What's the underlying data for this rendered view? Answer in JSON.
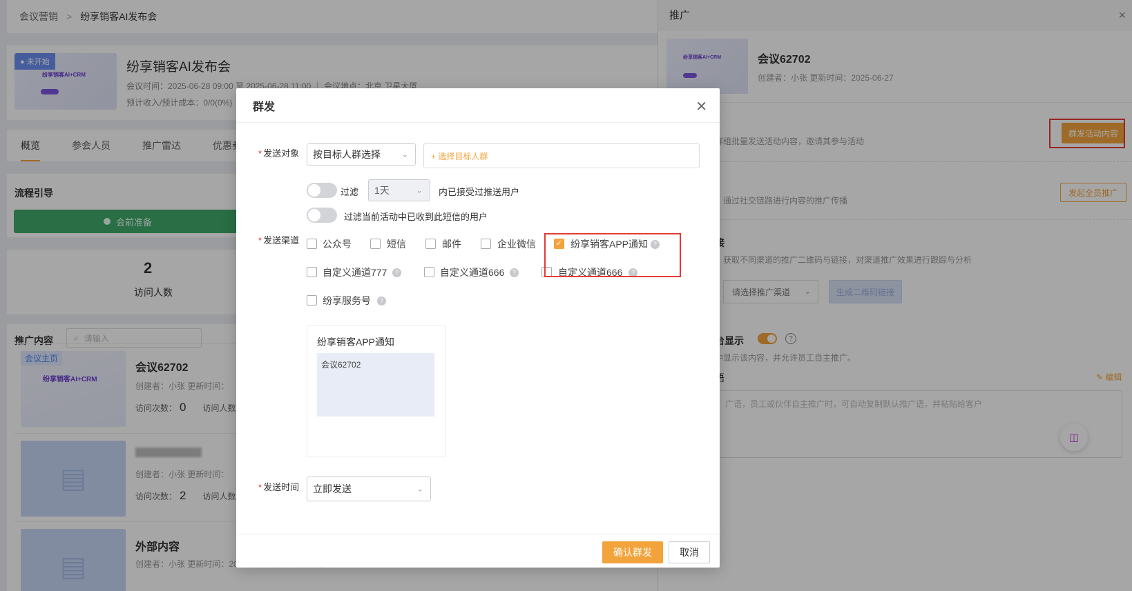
{
  "breadcrumb": {
    "parent": "会议营销",
    "separator": ">",
    "current": "纷享销客AI发布会"
  },
  "event": {
    "status": "● 未开始",
    "thumb_brand": "纷享销客AI+CRM",
    "title": "纷享销客AI发布会",
    "meta_line": "会议时间：2025-06-28 09:00 至 2025-06-28 11:00  ｜  会议地点：北京 卫星大厦",
    "cost_line": "预计收入/预计成本：0/0(0%)"
  },
  "tabs": [
    "概览",
    "参会人员",
    "推广雷达",
    "优惠券"
  ],
  "flow": {
    "title": "流程引导",
    "step": "会前准备"
  },
  "stats": {
    "value": "2",
    "label": "访问人数"
  },
  "promo": {
    "title": "推广内容",
    "search_placeholder": "请输入",
    "items": [
      {
        "tag": "会议主页",
        "brand": "纷享销客AI+CRM",
        "name": "会议62702",
        "meta": "创建者：小张    更新时间：",
        "visits_label": "访问次数：",
        "visits": "0",
        "people_label": "访问人数："
      },
      {
        "name": "",
        "meta": "创建者：小张    更新时间：",
        "visits_label": "访问次数：",
        "visits": "2",
        "people_label": "访问人数："
      },
      {
        "name": "外部内容",
        "meta": "创建者：小张    更新时间：2025-06-27    类型：外部内容"
      }
    ]
  },
  "drawer": {
    "title": "推广",
    "close": "×",
    "thumb_brand": "纷享销客AI+CRM",
    "item_title": "会议62702",
    "item_meta": "创建者：小张    更新时间：2025-06-27",
    "mass_desc": "群组批量发送活动内容，邀请其参与活动",
    "mass_button": "群发活动内容",
    "all_desc": "，通过社交链路进行内容的推广传播",
    "all_button": "发起全员推广",
    "link_title": "接",
    "link_desc": "，获取不同渠道的推广二维码与链接，对渠道推广效果进行跟踪与分析",
    "channel_placeholder": "请选择推广渠道",
    "gen_button": "生成二维码链接",
    "show_title": "台显示",
    "show_desc": "中显示该内容，并允许员工自主推广。",
    "lang_title": "语",
    "edit_label": "✎ 编辑",
    "textarea_placeholder": "广语，员工或伙伴自主推广时，可自动复制默认推广语，并粘贴给客户"
  },
  "modal": {
    "title": "群发",
    "target_label": "发送对象",
    "target_select": "按目标人群选择",
    "target_add": "+ 选择目标人群",
    "filter_label": "过滤",
    "filter_days": "1天",
    "filter_suffix": "内已接受过推送用户",
    "filter_sms": "过滤当前活动中已收到此短信的用户",
    "channel_label": "发送渠道",
    "channels": [
      {
        "label": "公众号",
        "checked": false
      },
      {
        "label": "短信",
        "checked": false
      },
      {
        "label": "邮件",
        "checked": false
      },
      {
        "label": "企业微信",
        "checked": false
      },
      {
        "label": "纷享销客APP通知",
        "checked": true
      },
      {
        "label": "自定义通道777",
        "checked": false
      },
      {
        "label": "自定义通道666",
        "checked": false
      },
      {
        "label": "自定义通道666",
        "checked": false
      },
      {
        "label": "纷享服务号",
        "checked": false
      }
    ],
    "preview_title": "纷享销客APP通知",
    "preview_body": "会议62702",
    "time_label": "发送时间",
    "time_select": "立即发送",
    "confirm": "确认群发",
    "cancel": "取消"
  }
}
